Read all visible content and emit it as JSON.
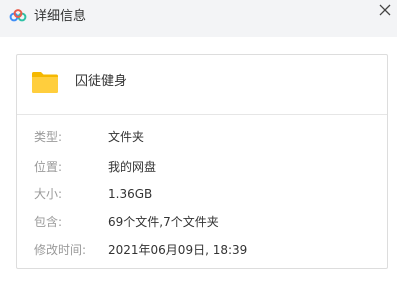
{
  "window": {
    "title": "详细信息",
    "logo_icon": "baidu-netdisk-logo-icon",
    "close_icon": "close-icon"
  },
  "file": {
    "icon": "folder-icon",
    "name": "囚徒健身"
  },
  "details": [
    {
      "label": "类型:",
      "value": "文件夹"
    },
    {
      "label": "位置:",
      "value": "我的网盘"
    },
    {
      "label": "大小:",
      "value": "1.36GB"
    },
    {
      "label": "包含:",
      "value": "69个文件,7个文件夹"
    },
    {
      "label": "修改时间:",
      "value": "2021年06月09日, 18:39"
    }
  ],
  "colors": {
    "titlebar_bg": "#f3f4f6",
    "folder_yellow": "#ffce3d",
    "label_gray": "#9a9a9a",
    "text_dark": "#333333",
    "border": "#dddddd"
  }
}
